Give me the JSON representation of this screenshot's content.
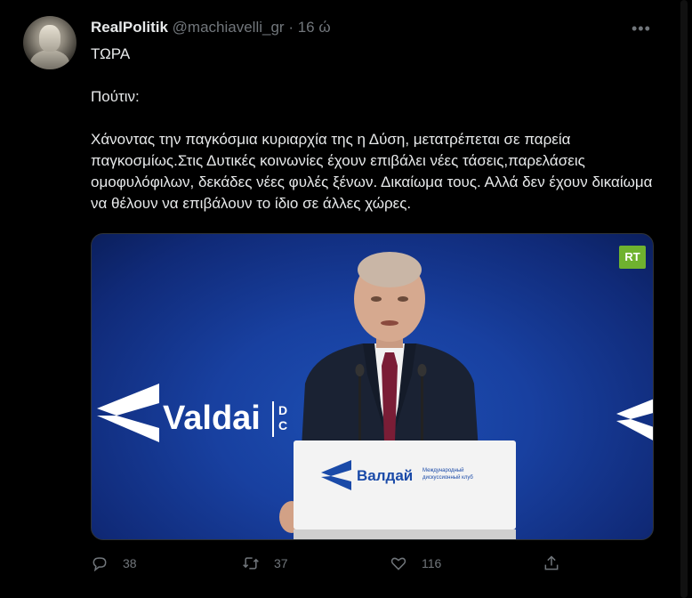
{
  "tweet": {
    "display_name": "RealPolitik",
    "handle": "@machiavelli_gr",
    "separator": "·",
    "time": "16 ώ",
    "more_icon": "more-horizontal-icon",
    "text_lines": [
      "ΤΩΡΑ",
      "",
      "Πούτιν:",
      "",
      "Χάνοντας την παγκόσμια κυριαρχία της η Δύση, μετατρέπεται σε παρεία παγκοσμίως.Στις Δυτικές κοινωνίες έχουν επιβάλει νέες τάσεις,παρελάσεις ομοφυλόφιλων, δεκάδες νέες φυλές ξένων. Δικαίωμα τους. Αλλά δεν έχουν δικαίωμα να θέλουν να επιβάλουν το ίδιο σε άλλες χώρες."
    ]
  },
  "media": {
    "channel_logo": "RT",
    "background_brand": "Valdai",
    "background_small": [
      "D",
      "C"
    ],
    "podium_brand": "Валдай",
    "podium_subtitle": [
      "Международный",
      "дискуссионный клуб"
    ]
  },
  "actions": {
    "reply": {
      "icon": "reply-icon",
      "count": "38"
    },
    "retweet": {
      "icon": "retweet-icon",
      "count": "37"
    },
    "like": {
      "icon": "like-icon",
      "count": "116"
    },
    "share": {
      "icon": "share-icon"
    }
  },
  "colors": {
    "background": "#000000",
    "text": "#e7e9ea",
    "muted": "#71767b",
    "border": "#2f3336",
    "rt_green": "#6fb22f"
  }
}
